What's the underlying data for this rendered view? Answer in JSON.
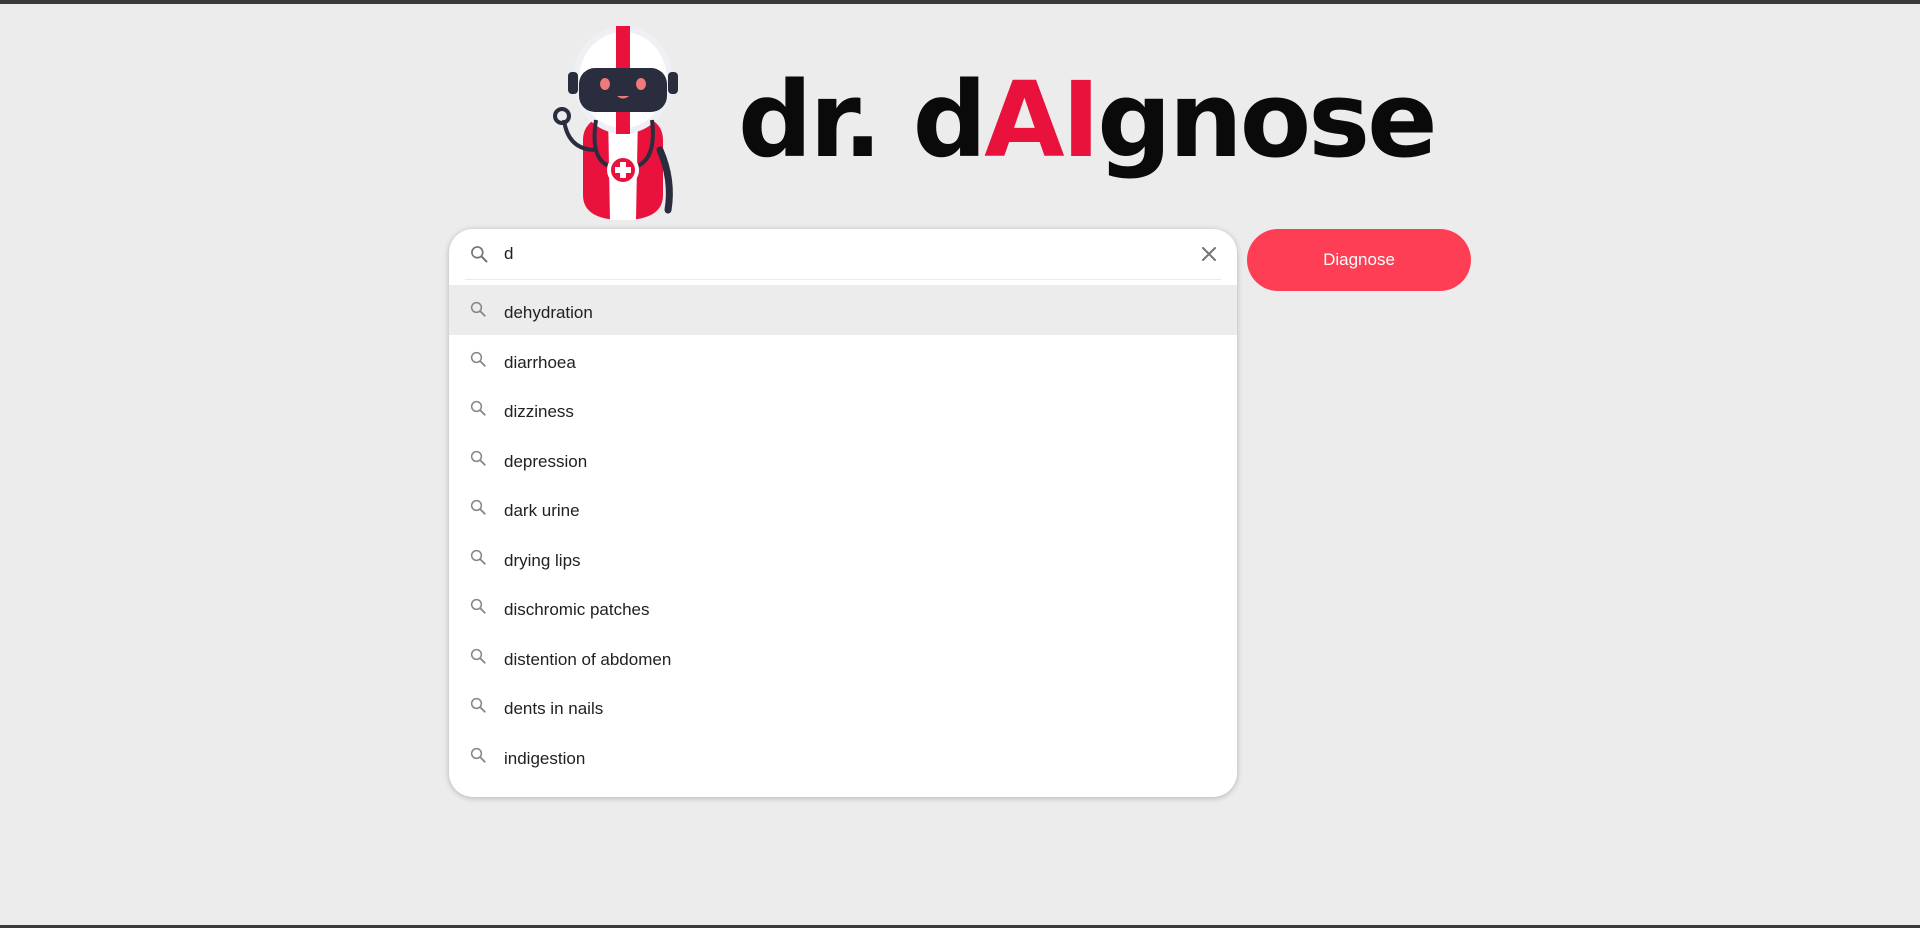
{
  "header": {
    "brand_prefix": "dr. d",
    "brand_ai": "AI",
    "brand_suffix": "gnose",
    "logo_icon": "robot-doctor-icon"
  },
  "search": {
    "value": "d",
    "search_icon": "search-icon",
    "clear_icon": "close-icon"
  },
  "suggestions": [
    {
      "label": "dehydration",
      "active": true
    },
    {
      "label": "diarrhoea"
    },
    {
      "label": "dizziness"
    },
    {
      "label": "depression"
    },
    {
      "label": "dark urine"
    },
    {
      "label": "drying lips"
    },
    {
      "label": "dischromic patches"
    },
    {
      "label": "distention of abdomen"
    },
    {
      "label": "dents in nails"
    },
    {
      "label": "indigestion"
    }
  ],
  "actions": {
    "diagnose_label": "Diagnose"
  },
  "colors": {
    "background": "#ececec",
    "accent": "#fe3e54",
    "brand_red": "#e8123c"
  }
}
